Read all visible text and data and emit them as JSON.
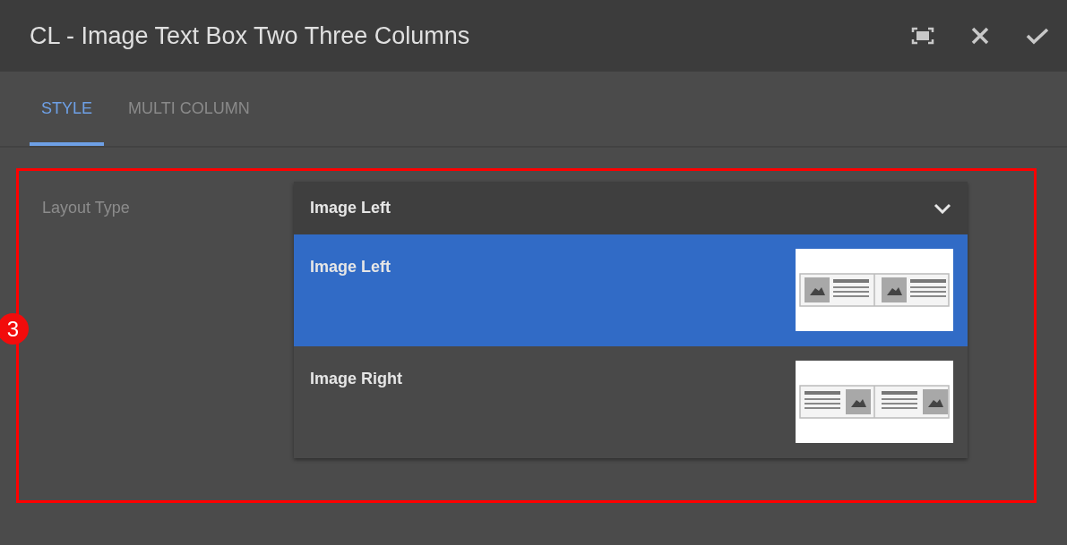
{
  "window": {
    "title": "CL - Image Text Box Two Three Columns"
  },
  "toolbar": [
    {
      "kind": "fullscreen"
    },
    {
      "kind": "close"
    },
    {
      "kind": "done"
    }
  ],
  "tabs": [
    {
      "label": "STYLE",
      "selected": true
    },
    {
      "label": "MULTI COLUMN",
      "selected": false
    }
  ],
  "field": {
    "label": "Layout Type",
    "value": "Image Left",
    "expanded": true,
    "options": [
      {
        "label": "Image Left",
        "kind": "image-left",
        "selected": true
      },
      {
        "label": "Image Right",
        "kind": "image-right",
        "selected": false
      }
    ]
  },
  "annotation": {
    "number": "3"
  }
}
